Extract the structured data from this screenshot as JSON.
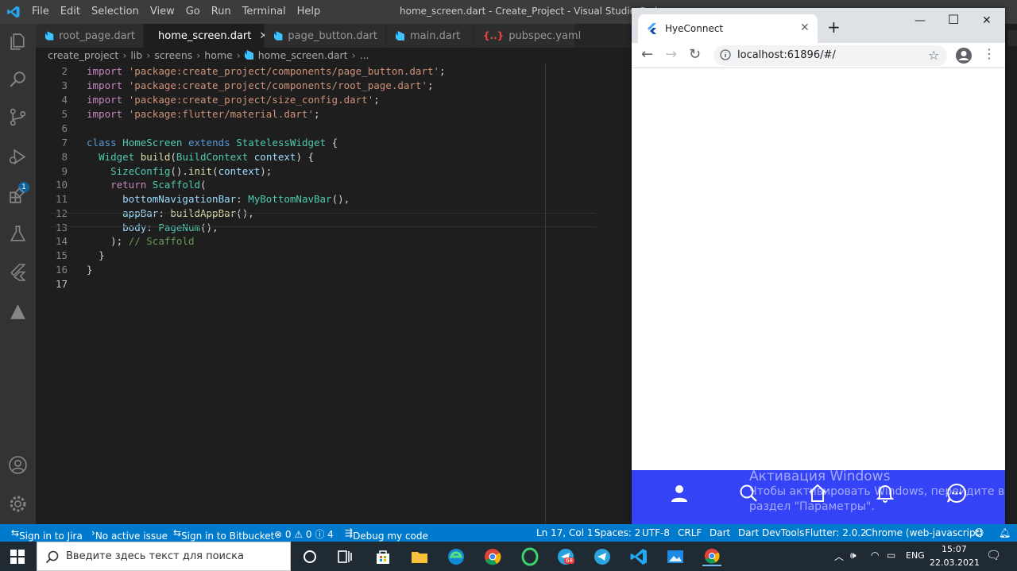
{
  "vscode": {
    "menu": [
      "File",
      "Edit",
      "Selection",
      "View",
      "Go",
      "Run",
      "Terminal",
      "Help"
    ],
    "window_title": "home_screen.dart - Create_Project - Visual Studio Code",
    "activity_badge": "1",
    "tabs": [
      {
        "label": "root_page.dart",
        "icon": "dart-icon"
      },
      {
        "label": "home_screen.dart",
        "icon": "dart-icon",
        "active": true,
        "close": "✕"
      },
      {
        "label": "page_button.dart",
        "icon": "dart-icon"
      },
      {
        "label": "main.dart",
        "icon": "dart-icon"
      },
      {
        "label": "pubspec.yaml",
        "icon": "yaml-icon",
        "icon_text": "{..}"
      }
    ],
    "breadcrumb": [
      "create_project",
      "lib",
      "screens",
      "home",
      "home_screen.dart",
      "..."
    ],
    "line_numbers": [
      "2",
      "3",
      "4",
      "5",
      "6",
      "7",
      "8",
      "9",
      "10",
      "11",
      "12",
      "13",
      "14",
      "15",
      "16",
      "17"
    ],
    "code": {
      "l2_kw": "import",
      "l2_str": "'package:create_project/components/page_button.dart'",
      "l2_end": ";",
      "l3_kw": "import",
      "l3_str": "'package:create_project/components/root_page.dart'",
      "l3_end": ";",
      "l4_kw": "import",
      "l4_str": "'package:create_project/size_config.dart'",
      "l4_end": ";",
      "l5_kw": "import",
      "l5_str": "'package:flutter/material.dart'",
      "l5_end": ";",
      "l7_kw1": "class",
      "l7_cls": "HomeScreen",
      "l7_kw2": "extends",
      "l7_cls2": "StatelessWidget",
      "l7_end": " {",
      "l8_cls": "Widget",
      "l8_fn": "build",
      "l8_p": "(",
      "l8_cls2": "BuildContext",
      "l8_prm": "context",
      "l8_end": ") {",
      "l9_cls": "SizeConfig",
      "l9_a": "().",
      "l9_fn": "init",
      "l9_b": "(",
      "l9_prm": "context",
      "l9_end": ");",
      "l10_kw": "return",
      "l10_cls": "Scaffold",
      "l10_end": "(",
      "l11_prm": "bottomNavigationBar",
      "l11_a": ": ",
      "l11_cls": "MyBottomNavBar",
      "l11_end": "(),",
      "l12_prm": "appBar",
      "l12_a": ": ",
      "l12_fn": "buildAppBar",
      "l12_end": "(),",
      "l13_prm": "body",
      "l13_a": ": ",
      "l13_cls": "PageNum",
      "l13_end": "(),",
      "l14_a": "); ",
      "l14_cmt": "// Scaffold",
      "l15": "}",
      "l16": "}"
    },
    "status": {
      "jira": "Sign in to Jira",
      "issue": "No active issue",
      "bitbucket": "Sign in to Bitbucket",
      "problems": "⊗ 0 ⚠ 0 ⓘ 4",
      "debug": "Debug my code",
      "position": "Ln 17, Col 1",
      "spaces": "Spaces: 2",
      "encoding": "UTF-8",
      "eol": "CRLF",
      "lang": "Dart",
      "devtools": "Dart DevTools",
      "flutter": "Flutter: 2.0.2",
      "device": "Chrome (web-javascript)"
    }
  },
  "chrome": {
    "tab_title": "HyeConnect",
    "tab_close": "✕",
    "new_tab": "+",
    "url": "localhost:61896/#/",
    "controls": {
      "minimize": "—",
      "maximize": "☐",
      "close": "✕"
    },
    "bottom_nav_icons": [
      "person-icon",
      "search-icon",
      "home-icon",
      "bell-icon",
      "chat-icon"
    ],
    "brand_color": "#3443f5"
  },
  "watermark": {
    "title": "Активация Windows",
    "line1": "Чтобы активировать Windows, перейдите в",
    "line2": "раздел \"Параметры\"."
  },
  "taskbar": {
    "search_placeholder": "Введите здесь текст для поиска",
    "lang": "ENG",
    "time": "15:07",
    "date": "22.03.2021",
    "telegram_badge": "68"
  }
}
